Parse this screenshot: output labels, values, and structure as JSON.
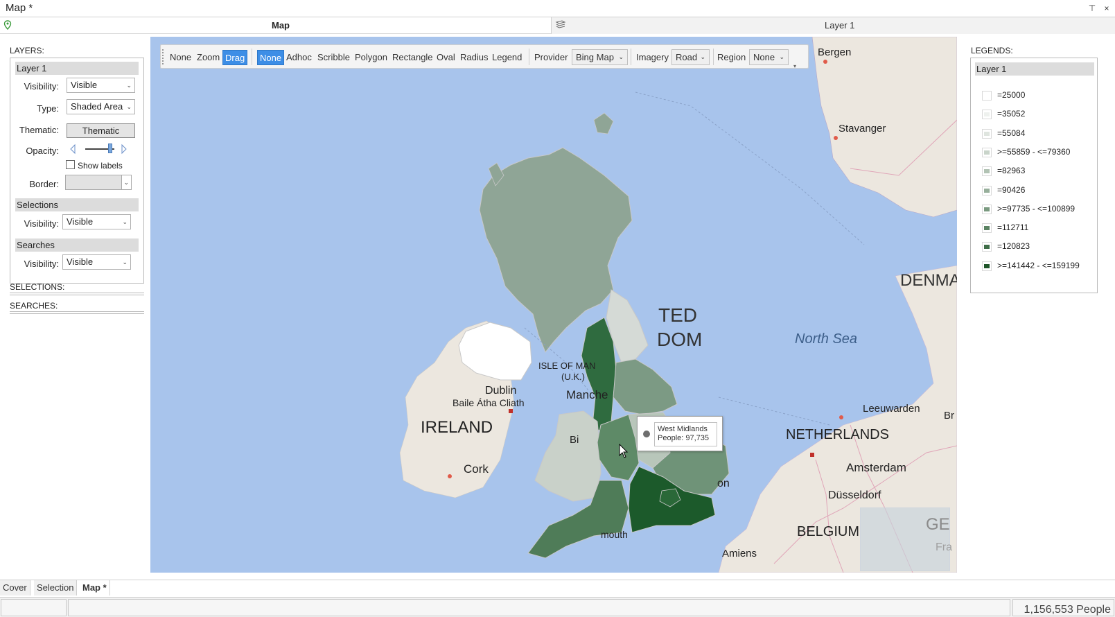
{
  "window": {
    "title": "Map *",
    "pin_glyph": "📌",
    "close_glyph": "×"
  },
  "header": {
    "map_title": "Map",
    "layer_title": "Layer 1"
  },
  "left_panel": {
    "layers_caption": "LAYERS:",
    "layer_group": "Layer 1",
    "visibility_label": "Visibility:",
    "visibility_value": "Visible",
    "type_label": "Type:",
    "type_value": "Shaded Area",
    "thematic_label": "Thematic:",
    "thematic_button": "Thematic",
    "opacity_label": "Opacity:",
    "opacity_level": 0.85,
    "show_labels": "Show labels",
    "show_labels_checked": false,
    "border_label": "Border:",
    "selections_group": "Selections",
    "selections_visibility_label": "Visibility:",
    "selections_visibility_value": "Visible",
    "searches_group": "Searches",
    "searches_visibility_label": "Visibility:",
    "searches_visibility_value": "Visible",
    "selections_caption": "SELECTIONS:",
    "searches_caption": "SEARCHES:"
  },
  "toolbar": {
    "nav_modes": [
      "None",
      "Zoom",
      "Drag"
    ],
    "nav_active": "Drag",
    "draw_modes": [
      "None",
      "Adhoc",
      "Scribble",
      "Polygon",
      "Rectangle",
      "Oval",
      "Radius",
      "Legend"
    ],
    "draw_active": "None",
    "provider_label": "Provider",
    "provider_value": "Bing Map",
    "imagery_label": "Imagery",
    "imagery_value": "Road",
    "region_label": "Region",
    "region_value": "None"
  },
  "map": {
    "labels": {
      "bergen": "Bergen",
      "stavanger": "Stavanger",
      "denmark": "DENMA",
      "north_sea": "North Sea",
      "united": "TED",
      "kingdom": "DOM",
      "isle_of_man_1": "ISLE OF MAN",
      "isle_of_man_2": "(U.K.)",
      "dublin": "Dublin",
      "baile": "Baile Átha Cliath",
      "ireland": "IRELAND",
      "manchester": "Manche",
      "birmingham": "Bi",
      "cork": "Cork",
      "leeuwarden": "Leeuwarden",
      "br": "Br",
      "netherlands": "NETHERLANDS",
      "amsterdam": "Amsterdam",
      "dusseldorf": "Düsseldorf",
      "belgium": "BELGIUM",
      "amiens": "Amiens",
      "london": "on",
      "plymouth": "mouth",
      "ge": "GE",
      "fra": "Fra"
    },
    "tooltip": {
      "region": "West Midlands",
      "value_text": "People: 97,735"
    },
    "colors": {
      "sea": "#a8c4ec",
      "land": "#ece7df",
      "scotland": "#8fa596",
      "northern_ireland": "#ffffff",
      "wales": "#c9d1c9",
      "north_east": "#d5dad6",
      "north_west": "#2f6b3f",
      "yorkshire": "#7c9a84",
      "east_midlands": "#b8c6ba",
      "west_midlands": "#5e8a67",
      "east_england": "#6f9378",
      "south_west": "#4f7c58",
      "south_east": "#1c5a2b",
      "london": "#2a6838"
    }
  },
  "legend_panel": {
    "caption": "LEGENDS:",
    "layer": "Layer 1",
    "items": [
      {
        "label": "=25000",
        "color": "#ffffff"
      },
      {
        "label": "=35052",
        "color": "#eef1ee"
      },
      {
        "label": "=55084",
        "color": "#dfe5df"
      },
      {
        "label": ">=55859 - <=79360",
        "color": "#c9d4ca"
      },
      {
        "label": "=82963",
        "color": "#b2c3b4"
      },
      {
        "label": "=90426",
        "color": "#97af9b"
      },
      {
        "label": ">=97735 - <=100899",
        "color": "#7a9a80"
      },
      {
        "label": "=112711",
        "color": "#5b8363"
      },
      {
        "label": "=120823",
        "color": "#3f6d48"
      },
      {
        "label": ">=141442 - <=159199",
        "color": "#1f5529"
      }
    ]
  },
  "bottom_tabs": [
    {
      "label": "Cover",
      "active": false
    },
    {
      "label": "Selection",
      "active": false
    },
    {
      "label": "Map *",
      "active": true
    }
  ],
  "status": {
    "total": "1,156,553 People"
  }
}
